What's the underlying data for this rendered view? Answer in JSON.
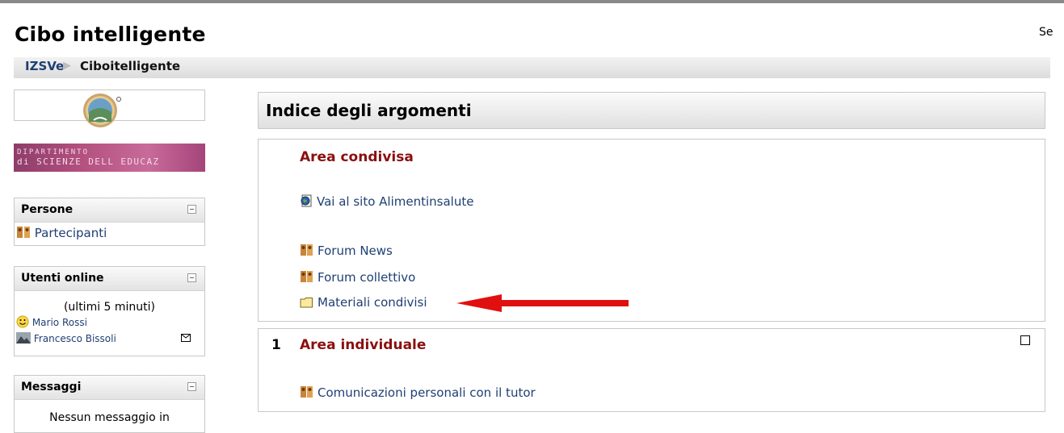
{
  "site": {
    "title": "Cibo intelligente",
    "top_right_text": "Se"
  },
  "breadcrumb": {
    "root": "IZSVe",
    "current": "Ciboitelligente"
  },
  "sidebar": {
    "dept_banner": {
      "line1": "DIPARTIMENTO",
      "line2": "di SCIENZE DELL EDUCAZ"
    },
    "persone": {
      "title": "Persone",
      "items": [
        {
          "label": "Partecipanti",
          "icon": "people-icon"
        }
      ]
    },
    "utenti_online": {
      "title": "Utenti online",
      "subtitle": "(ultimi 5 minuti)",
      "users": [
        {
          "name": "Mario Rossi",
          "icon": "smiley-avatar"
        },
        {
          "name": "Francesco Bissoli",
          "icon": "photo-avatar",
          "message_icon": "envelope-icon"
        }
      ]
    },
    "messaggi": {
      "title": "Messaggi",
      "body": "Nessun messaggio in"
    }
  },
  "main": {
    "header": "Indice degli argomenti",
    "sections": [
      {
        "title": "Area condivisa",
        "activities": [
          {
            "label": "Vai al sito Alimentinsalute",
            "icon": "globe-page-icon"
          },
          {
            "label": "Forum News",
            "icon": "forum-icon"
          },
          {
            "label": "Forum collettivo",
            "icon": "forum-icon"
          },
          {
            "label": "Materiali condivisi",
            "icon": "folder-icon",
            "highlighted_by": "red-arrow"
          }
        ]
      },
      {
        "number": "1",
        "title": "Area individuale",
        "activities": [
          {
            "label": "Comunicazioni personali con il tutor",
            "icon": "forum-icon"
          }
        ]
      }
    ]
  },
  "colors": {
    "link": "#1f3f73",
    "section_title": "#8b0f0f",
    "annotation_arrow": "#e01010"
  }
}
